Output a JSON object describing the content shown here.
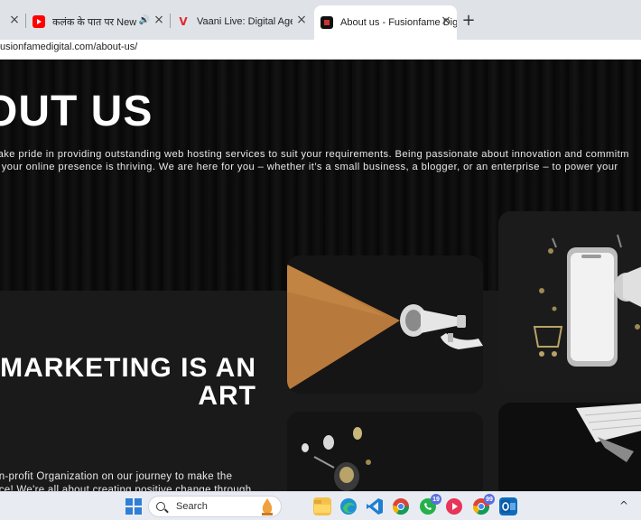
{
  "browser": {
    "tabs": [
      {
        "title": "",
        "close": "×"
      },
      {
        "title": "कलंक के पात पर New Versio",
        "audio": "🔊",
        "close": "×"
      },
      {
        "title": "Vaani Live: Digital Agency, Web",
        "close": "×"
      },
      {
        "title": "About us - Fusionfame Digital",
        "close": "×"
      }
    ],
    "new_tab": "+",
    "url": "usionfamedigital.com/about-us/"
  },
  "page": {
    "hero_title": "OUT US",
    "hero_line_1": "ve take pride in providing outstanding web hosting services to suit your requirements. Being passionate about innovation and commitm",
    "hero_line_2": "that your online presence is thriving. We are here for you – whether it’s a small business, a blogger, or an enterprise – to power your",
    "marketing_title_1": "MARKETING IS AN",
    "marketing_title_2": "ART",
    "marketing_line_1": "on-profit Organization on our journey to make the",
    "marketing_line_2": "ace! We're all about creating positive change through"
  },
  "taskbar": {
    "search_label": "Search",
    "whatsapp_badge": "19",
    "chrome_badge": "99"
  }
}
